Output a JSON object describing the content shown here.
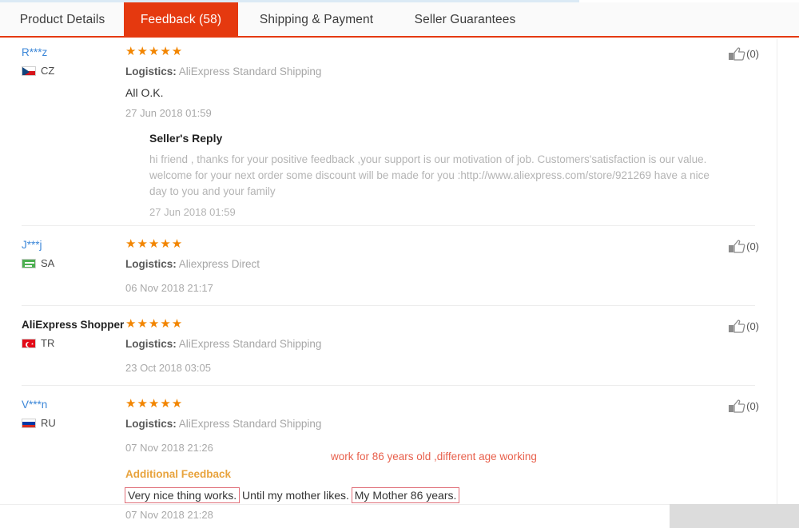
{
  "tabs": [
    {
      "label": "Product Details",
      "active": false
    },
    {
      "label": "Feedback (58)",
      "active": true
    },
    {
      "label": "Shipping & Payment",
      "active": false
    },
    {
      "label": "Seller Guarantees",
      "active": false
    }
  ],
  "colors": {
    "accent": "#e5390f",
    "star": "#f28500",
    "link": "#3c87d8",
    "annotation": "#e8604c",
    "additional_feedback": "#e8a33d"
  },
  "logistics_label": "Logistics:",
  "thumb_count": "(0)",
  "annotation": {
    "note": "work for 86 years old ,different age working",
    "boxed_1": "Very nice thing works.",
    "middle": " Until my mother likes. ",
    "boxed_2": "My Mother 86 years."
  },
  "feedback": [
    {
      "buyer": "R***z",
      "buyer_is_link": true,
      "country_code": "CZ",
      "flag": "cz-flag",
      "stars": 5,
      "logistics": "AliExpress Standard Shipping",
      "review_text": "All O.K.",
      "date": "27 Jun 2018 01:59",
      "helpful": "(0)",
      "reply": {
        "title": "Seller's Reply",
        "body": "hi friend , thanks for your positive feedback ,your support is our motivation of job. Customers'satisfaction is our value. welcome for your next order some discount will be made for you :http://www.aliexpress.com/store/921269 have a nice day to you and your family",
        "date": "27 Jun 2018 01:59"
      }
    },
    {
      "buyer": "J***j",
      "buyer_is_link": true,
      "country_code": "SA",
      "flag": "sa-flag",
      "stars": 5,
      "logistics": "Aliexpress Direct",
      "review_text": "",
      "date": "06 Nov 2018 21:17",
      "helpful": "(0)"
    },
    {
      "buyer": "AliExpress Shopper",
      "buyer_is_link": false,
      "country_code": "TR",
      "flag": "tr-flag",
      "stars": 5,
      "logistics": "AliExpress Standard Shipping",
      "review_text": "",
      "date": "23 Oct 2018 03:05",
      "helpful": "(0)"
    },
    {
      "buyer": "V***n",
      "buyer_is_link": true,
      "country_code": "RU",
      "flag": "ru-flag",
      "stars": 5,
      "logistics": "AliExpress Standard Shipping",
      "review_text": "",
      "date": "07 Nov 2018 21:26",
      "helpful": "(0)",
      "additional": {
        "title": "Additional Feedback",
        "date": "07 Nov 2018 21:28"
      }
    }
  ]
}
